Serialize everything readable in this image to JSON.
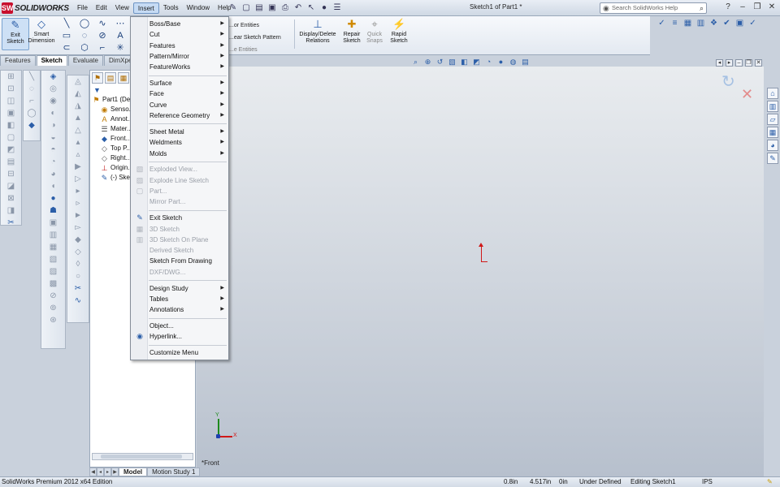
{
  "app": {
    "logo": "SOLIDWORKS",
    "logo_mark": "SW",
    "doc_title": "Sketch1 of Part1 *"
  },
  "menubar": [
    "File",
    "Edit",
    "View",
    "Insert",
    "Tools",
    "Window",
    "Help"
  ],
  "search": {
    "placeholder": "Search SolidWorks Help"
  },
  "command_manager": {
    "exit_sketch": "Exit Sketch",
    "smart_dimension": "Smart Dimension",
    "convert_entities": "...or Entities",
    "linear_pattern": "...ear Sketch Pattern",
    "move_entities": "...e Entities",
    "display_delete": "Display/Delete Relations",
    "repair_sketch": "Repair Sketch",
    "quick_snaps": "Quick Snaps",
    "rapid_sketch": "Rapid Sketch"
  },
  "tabs": [
    "Features",
    "Sketch",
    "Evaluate",
    "DimXpert"
  ],
  "active_tab": "Sketch",
  "tree": {
    "root": "Part1  (De...",
    "items": [
      "Senso...",
      "Annot...",
      "Mater...",
      "Front...",
      "Top P...",
      "Right...",
      "Origin...",
      "(-) Ske..."
    ]
  },
  "bottom_tabs": [
    "Model",
    "Motion Study 1"
  ],
  "viewport": {
    "view_label": "*Front",
    "axis_x": "X",
    "axis_y": "Y"
  },
  "menu": {
    "items": [
      {
        "label": "Boss/Base",
        "sub": true,
        "disabled": false
      },
      {
        "label": "Cut",
        "sub": true,
        "disabled": false
      },
      {
        "label": "Features",
        "sub": true,
        "disabled": false
      },
      {
        "label": "Pattern/Mirror",
        "sub": true,
        "disabled": false
      },
      {
        "label": "FeatureWorks",
        "sub": true,
        "disabled": false
      },
      {
        "label": "Surface",
        "sub": true,
        "disabled": false
      },
      {
        "label": "Face",
        "sub": true,
        "disabled": false
      },
      {
        "label": "Curve",
        "sub": true,
        "disabled": false
      },
      {
        "label": "Reference Geometry",
        "sub": true,
        "disabled": false
      },
      {
        "label": "Sheet Metal",
        "sub": true,
        "disabled": false
      },
      {
        "label": "Weldments",
        "sub": true,
        "disabled": false
      },
      {
        "label": "Molds",
        "sub": true,
        "disabled": false
      },
      {
        "label": "Exploded View...",
        "sub": false,
        "disabled": true
      },
      {
        "label": "Explode Line Sketch",
        "sub": false,
        "disabled": true
      },
      {
        "label": "Part...",
        "sub": false,
        "disabled": true
      },
      {
        "label": "Mirror Part...",
        "sub": false,
        "disabled": true
      },
      {
        "label": "Exit Sketch",
        "sub": false,
        "disabled": false
      },
      {
        "label": "3D Sketch",
        "sub": false,
        "disabled": true
      },
      {
        "label": "3D Sketch On Plane",
        "sub": false,
        "disabled": true
      },
      {
        "label": "Derived Sketch",
        "sub": false,
        "disabled": true
      },
      {
        "label": "Sketch From Drawing",
        "sub": false,
        "disabled": false
      },
      {
        "label": "DXF/DWG...",
        "sub": false,
        "disabled": true
      },
      {
        "label": "Design Study",
        "sub": true,
        "disabled": false
      },
      {
        "label": "Tables",
        "sub": true,
        "disabled": false
      },
      {
        "label": "Annotations",
        "sub": true,
        "disabled": false
      },
      {
        "label": "Object...",
        "sub": false,
        "disabled": false
      },
      {
        "label": "Hyperlink...",
        "sub": false,
        "disabled": false
      },
      {
        "label": "Customize Menu",
        "sub": false,
        "disabled": false
      }
    ],
    "submenu_arrow": "▶"
  },
  "status": {
    "edition": "SolidWorks Premium 2012 x64 Edition",
    "x": "0.8in",
    "y": "4.517in",
    "z": "0in",
    "state": "Under Defined",
    "mode": "Editing Sketch1",
    "units": "IPS"
  },
  "colors": {
    "accent": "#2b5ea8",
    "origin": "#d01818",
    "brand": "#c8102e"
  }
}
